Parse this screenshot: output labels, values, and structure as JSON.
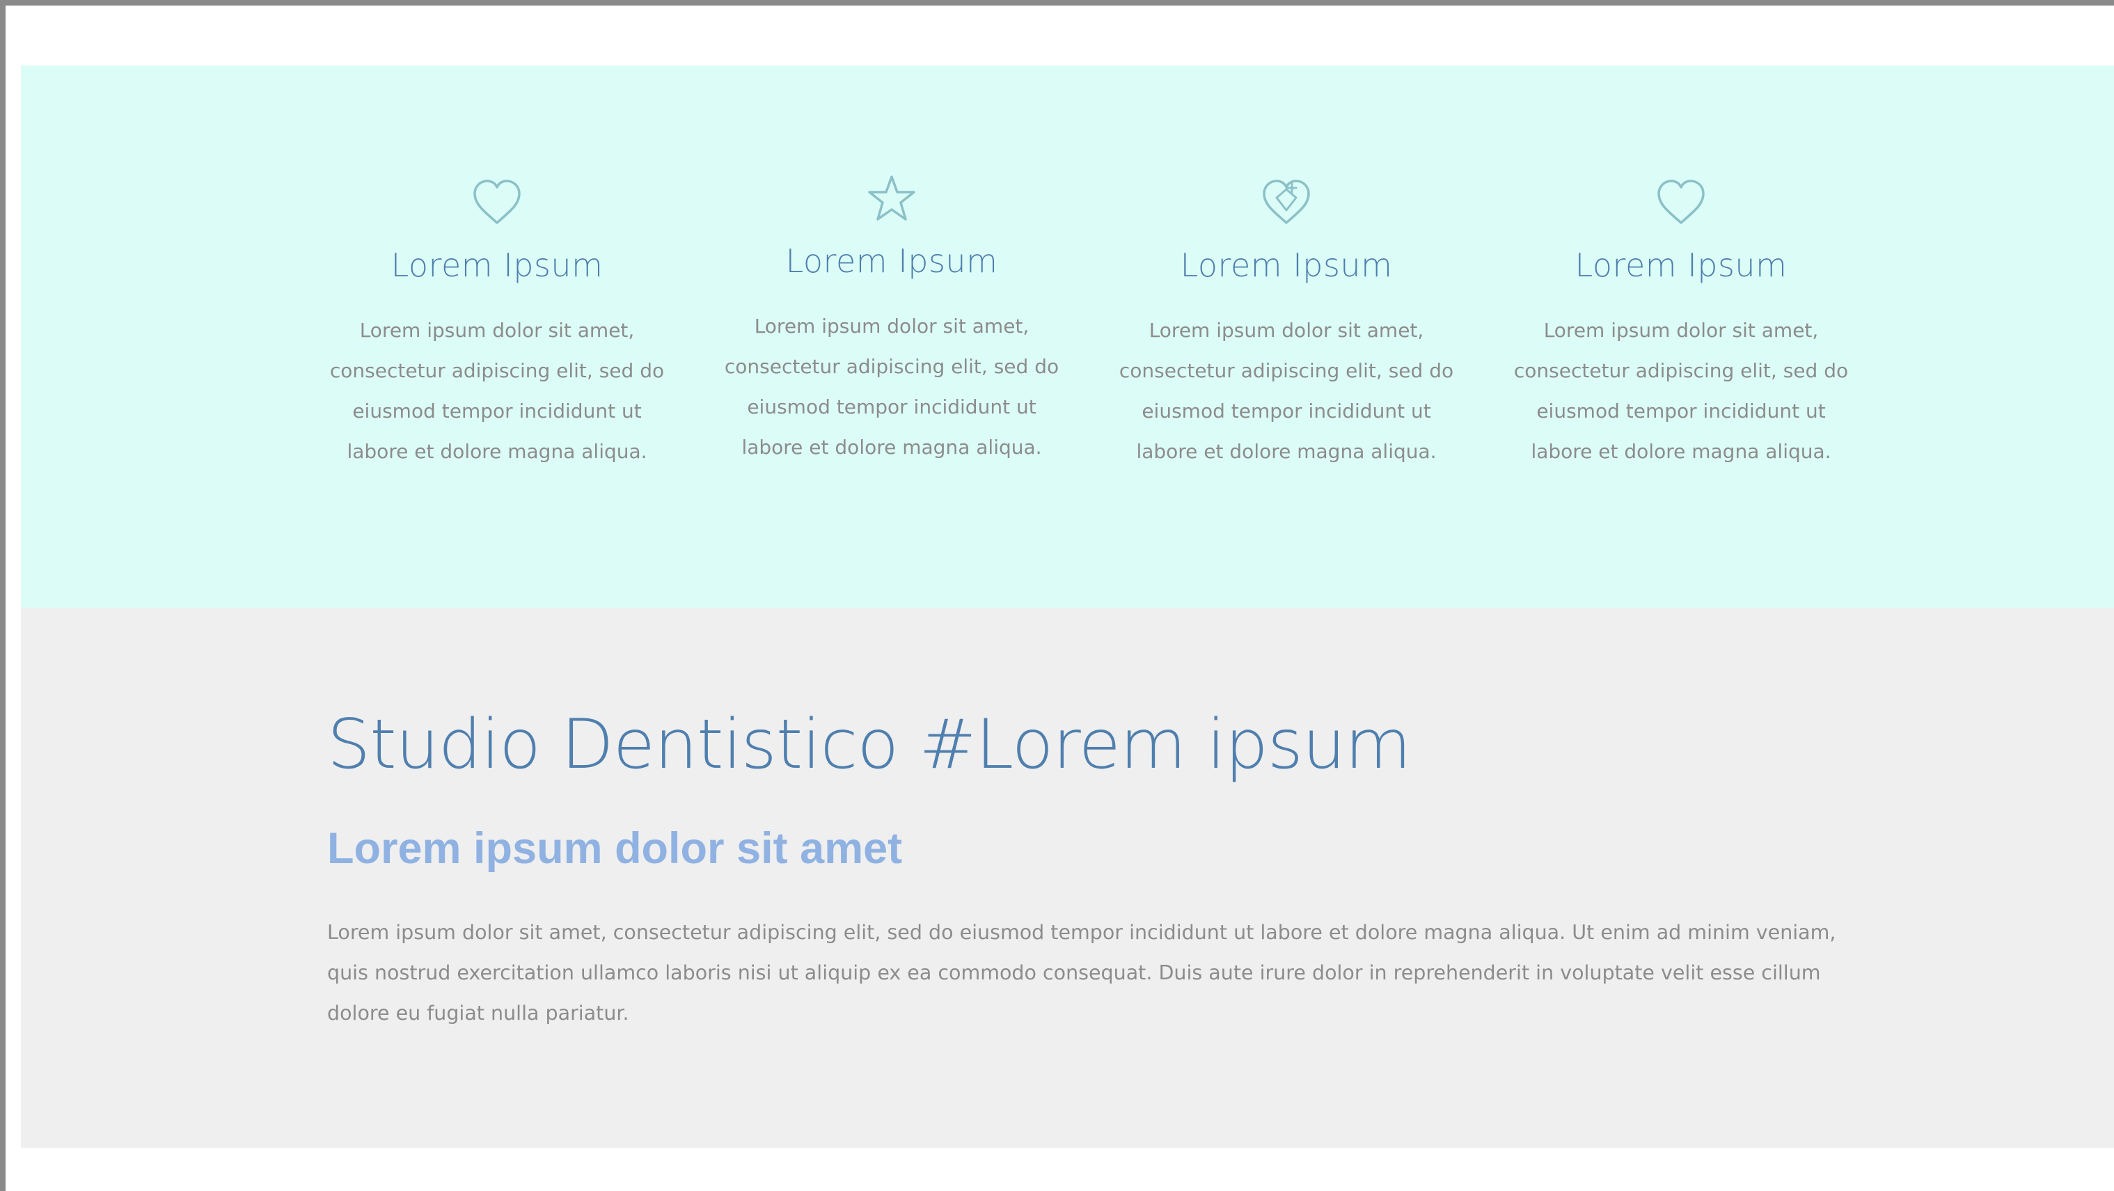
{
  "features": [
    {
      "icon": "heart-icon",
      "title": "Lorem Ipsum",
      "text": "Lorem ipsum dolor sit amet, consectetur adipiscing elit, sed do eiusmod tempor incididunt ut labore et dolore magna aliqua."
    },
    {
      "icon": "star-icon",
      "title": "Lorem Ipsum",
      "text": "Lorem ipsum dolor sit amet, consectetur adipiscing elit, sed do eiusmod tempor incididunt ut labore et dolore magna aliqua."
    },
    {
      "icon": "diamond-icon",
      "title": "Lorem Ipsum",
      "text": "Lorem ipsum dolor sit amet, consectetur adipiscing elit, sed do eiusmod tempor incididunt ut labore et dolore magna aliqua."
    },
    {
      "icon": "heart-icon",
      "title": "Lorem Ipsum",
      "text": "Lorem ipsum dolor sit amet, consectetur adipiscing elit, sed do eiusmod tempor incididunt ut labore et dolore magna aliqua."
    }
  ],
  "about": {
    "heading": "Studio Dentistico #Lorem ipsum",
    "subheading": "Lorem ipsum dolor sit amet",
    "paragraph": "Lorem ipsum dolor sit amet, consectetur adipiscing elit, sed do eiusmod tempor incididunt ut labore et dolore magna aliqua. Ut enim ad minim veniam, quis nostrud exercitation ullamco laboris nisi ut aliquip ex ea commodo consequat. Duis aute irure dolor in reprehenderit in voluptate velit esse cillum dolore eu fugiat nulla pariatur."
  },
  "colors": {
    "features_background": "#dcfdf7",
    "about_background": "#efefef",
    "title_blue": "#4f7fae",
    "subheading_blue": "#8fb2e2",
    "icon_stroke": "#8cc0c8",
    "body_text": "#8c8c8c"
  }
}
